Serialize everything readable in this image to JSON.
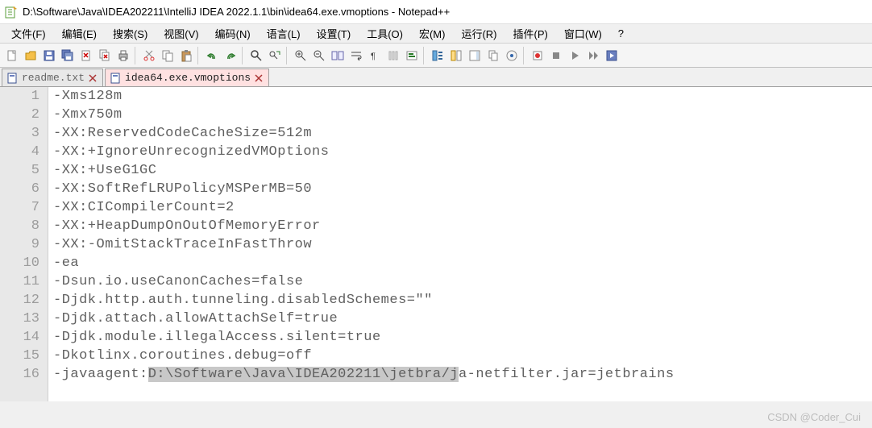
{
  "window": {
    "title": "D:\\Software\\Java\\IDEA202211\\IntelliJ IDEA 2022.1.1\\bin\\idea64.exe.vmoptions - Notepad++"
  },
  "menus": [
    {
      "label": "文件(F)"
    },
    {
      "label": "编辑(E)"
    },
    {
      "label": "搜索(S)"
    },
    {
      "label": "视图(V)"
    },
    {
      "label": "编码(N)"
    },
    {
      "label": "语言(L)"
    },
    {
      "label": "设置(T)"
    },
    {
      "label": "工具(O)"
    },
    {
      "label": "宏(M)"
    },
    {
      "label": "运行(R)"
    },
    {
      "label": "插件(P)"
    },
    {
      "label": "窗口(W)"
    },
    {
      "label": "?"
    }
  ],
  "tabs": [
    {
      "label": "readme.txt",
      "active": false
    },
    {
      "label": "idea64.exe.vmoptions",
      "active": true
    }
  ],
  "editor": {
    "lines": [
      "-Xms128m",
      "-Xmx750m",
      "-XX:ReservedCodeCacheSize=512m",
      "-XX:+IgnoreUnrecognizedVMOptions",
      "-XX:+UseG1GC",
      "-XX:SoftRefLRUPolicyMSPerMB=50",
      "-XX:CICompilerCount=2",
      "-XX:+HeapDumpOnOutOfMemoryError",
      "-XX:-OmitStackTraceInFastThrow",
      "-ea",
      "-Dsun.io.useCanonCaches=false",
      "-Djdk.http.auth.tunneling.disabledSchemes=\"\"",
      "-Djdk.attach.allowAttachSelf=true",
      "-Djdk.module.illegalAccess.silent=true",
      "-Dkotlinx.coroutines.debug=off"
    ],
    "line16": {
      "prefix": "-javaagent:",
      "selected": "D:\\Software\\Java\\IDEA202211\\jetbra/j",
      "suffix": "a-netfilter.jar=jetbrains"
    }
  },
  "watermark": "CSDN @Coder_Cui"
}
